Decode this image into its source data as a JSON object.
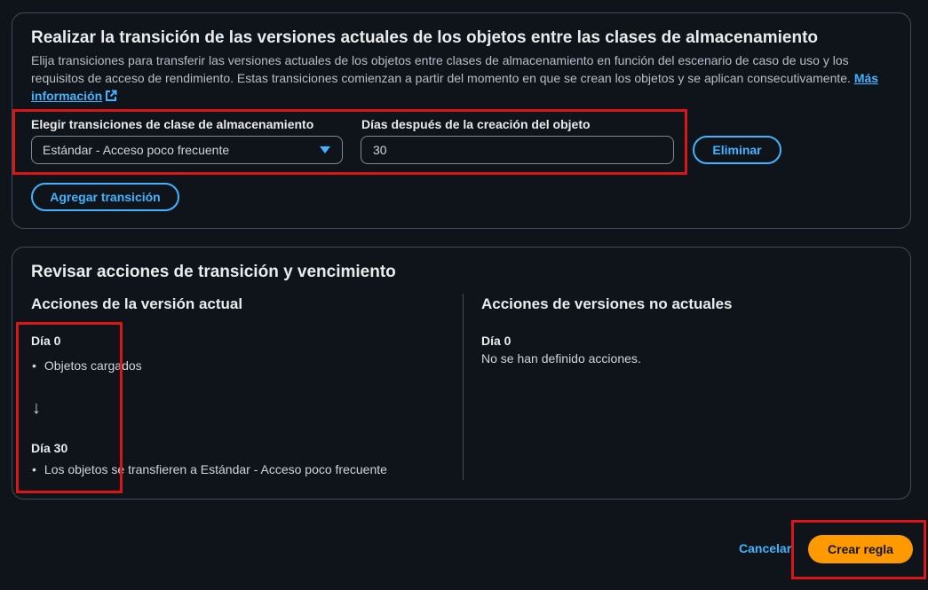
{
  "transition_section": {
    "title": "Realizar la transición de las versiones actuales de los objetos entre las clases de almacenamiento",
    "description": "Elija transiciones para transferir las versiones actuales de los objetos entre clases de almacenamiento en función del escenario de caso de uso y los requisitos de acceso de rendimiento. Estas transiciones comienzan a partir del momento en que se crean los objetos y se aplican consecutivamente.",
    "more_info_link": "Más información",
    "storage_class_label": "Elegir transiciones de clase de almacenamiento",
    "storage_class_value": "Estándar - Acceso poco frecuente",
    "days_label": "Días después de la creación del objeto",
    "days_value": "30",
    "remove_button": "Eliminar",
    "add_transition_button": "Agregar transición"
  },
  "review_section": {
    "title": "Revisar acciones de transición y vencimiento",
    "current": {
      "heading": "Acciones de la versión actual",
      "day0_label": "Día 0",
      "day0_item": "Objetos cargados",
      "arrow": "↓",
      "day30_label": "Día 30",
      "day30_item": "Los objetos se transfieren a Estándar - Acceso poco frecuente"
    },
    "noncurrent": {
      "heading": "Acciones de versiones no actuales",
      "day0_label": "Día 0",
      "day0_text": "No se han definido acciones."
    }
  },
  "footer": {
    "cancel": "Cancelar",
    "create": "Crear regla"
  },
  "colors": {
    "background": "#0f141a",
    "accent": "#42b4ff",
    "primary": "#ff9900",
    "highlight": "#d91515"
  },
  "icons": {
    "external_link": "external-link-icon",
    "dropdown": "caret-down-icon",
    "arrow": "arrow-down-icon"
  }
}
